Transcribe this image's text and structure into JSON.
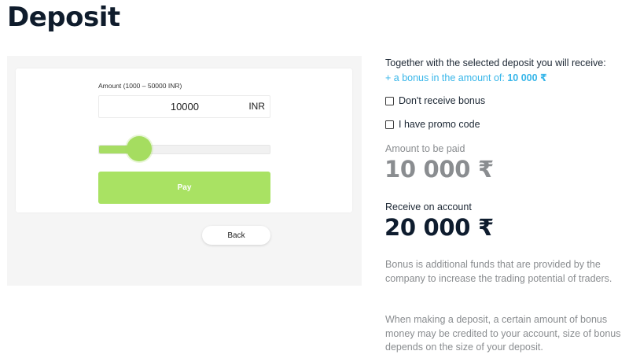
{
  "page": {
    "title": "Deposit"
  },
  "form": {
    "amount_label": "Amount (1000 – 50000 INR)",
    "amount_value": "10000",
    "currency": "INR",
    "slider_fraction": 0.2,
    "pay_label": "Pay",
    "back_label": "Back"
  },
  "summary": {
    "receive_text": "Together with the selected deposit you will receive:",
    "bonus_prefix": "+ a bonus in the amount of:",
    "bonus_amount": "10 000 ₹",
    "no_bonus_label": "Don't receive bonus",
    "promo_label": "I have promo code",
    "amount_paid_label": "Amount to be paid",
    "amount_paid_value": "10 000 ₹",
    "receive_label": "Receive on account",
    "receive_value": "20 000 ₹",
    "info_1": "Bonus is additional funds that are provided by the company to increase the trading potential of traders.",
    "info_2": "When making a deposit, a certain amount of bonus money may be credited to your account, size of bonus depends on the size of your deposit."
  },
  "colors": {
    "accent_green": "#a9e263",
    "bonus_blue": "#37b6e9",
    "title_navy": "#0f1c2c",
    "muted_gray": "#8a8d90"
  }
}
